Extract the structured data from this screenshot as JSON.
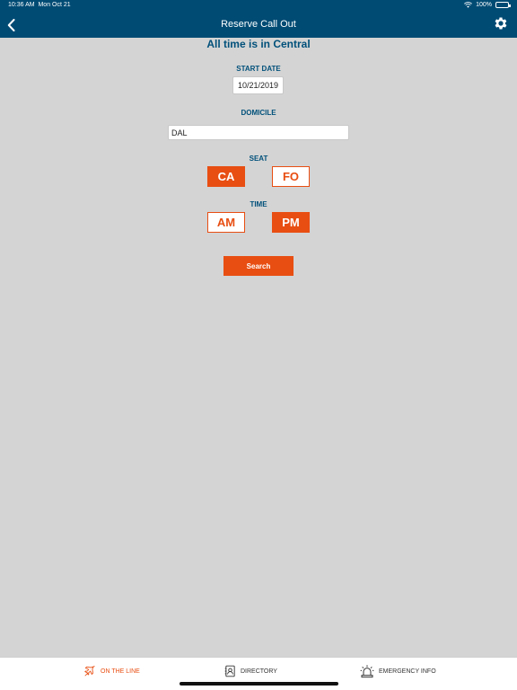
{
  "status_bar": {
    "time": "10:36 AM",
    "date": "Mon Oct 21",
    "battery": "100%",
    "battery_level": 1.0,
    "wifi_icon": "wifi-icon",
    "battery_icon": "battery-icon"
  },
  "nav": {
    "title": "Reserve Call Out",
    "back_icon": "chevron-left-icon",
    "settings_icon": "gear-icon"
  },
  "timezone_notice": "All time is in Central",
  "form": {
    "start_date_label": "START DATE",
    "start_date_value": "10/21/2019",
    "domicile_label": "DOMICILE",
    "domicile_value": "DAL",
    "seat_label": "SEAT",
    "seat_options": [
      {
        "label": "CA",
        "selected": true
      },
      {
        "label": "FO",
        "selected": false
      }
    ],
    "time_label": "TIME",
    "time_options": [
      {
        "label": "AM",
        "selected": false
      },
      {
        "label": "PM",
        "selected": true
      }
    ],
    "search_label": "Search"
  },
  "tabs": [
    {
      "label": "ON THE LINE",
      "icon": "airplane-icon",
      "active": true
    },
    {
      "label": "DIRECTORY",
      "icon": "contact-book-icon",
      "active": false
    },
    {
      "label": "EMERGENCY INFO",
      "icon": "alarm-light-icon",
      "active": false
    }
  ],
  "colors": {
    "header": "#004b74",
    "accent": "#e84e12",
    "label": "#00507a",
    "background": "#d4d4d4"
  }
}
